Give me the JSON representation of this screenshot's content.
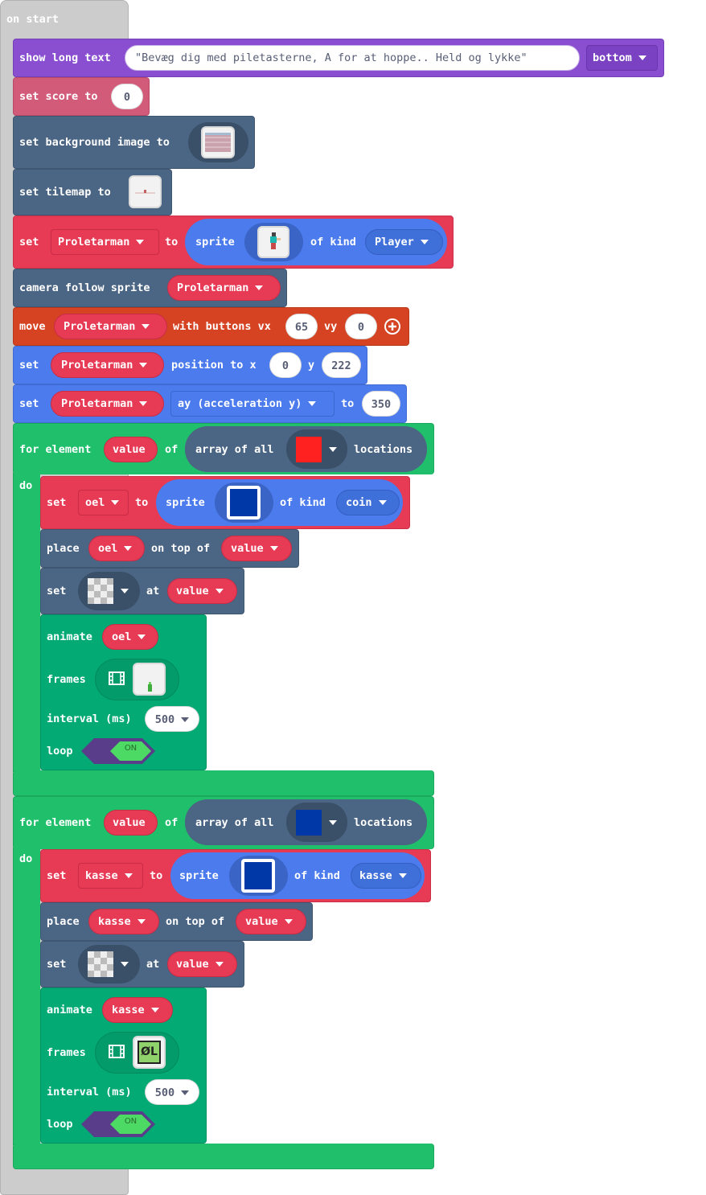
{
  "hat": {
    "label": "on start"
  },
  "show_text": {
    "label": "show long text",
    "text_value": "\"Bevæg dig med piletasterne, A for at hoppe.. Held og lykke\"",
    "position": "bottom"
  },
  "set_score": {
    "label": "set score to",
    "value": "0"
  },
  "set_background": {
    "label": "set background image to"
  },
  "set_tilemap": {
    "label": "set tilemap to"
  },
  "set_sprite": {
    "set": "set",
    "variable": "Proletarman",
    "to": "to",
    "sprite": "sprite",
    "of_kind": "of kind",
    "kind": "Player"
  },
  "camera": {
    "label": "camera follow sprite",
    "variable": "Proletarman"
  },
  "move": {
    "move": "move",
    "variable": "Proletarman",
    "with_buttons": "with buttons vx",
    "vx": "65",
    "vy_label": "vy",
    "vy": "0"
  },
  "position": {
    "set": "set",
    "variable": "Proletarman",
    "position_to": "position to x",
    "x": "0",
    "y_label": "y",
    "y": "222"
  },
  "accel": {
    "set": "set",
    "variable": "Proletarman",
    "property": "ay (acceleration y)",
    "to": "to",
    "value": "350"
  },
  "loop1": {
    "for_element": "for element",
    "value_var": "value",
    "of": "of",
    "array_of_all": "array of all",
    "locations": "locations",
    "do": "do",
    "tile_color": "#FF2020",
    "set": {
      "set": "set",
      "variable": "oel",
      "to": "to",
      "sprite": "sprite",
      "of_kind": "of kind",
      "kind": "coin"
    },
    "place": {
      "place": "place",
      "variable": "oel",
      "on_top_of": "on top of",
      "value": "value"
    },
    "settile": {
      "set": "set",
      "at": "at",
      "value": "value"
    },
    "animate": {
      "animate": "animate",
      "variable": "oel",
      "frames": "frames",
      "interval": "interval (ms)",
      "interval_value": "500",
      "loop": "loop",
      "toggle": "ON"
    }
  },
  "loop2": {
    "for_element": "for element",
    "value_var": "value",
    "of": "of",
    "array_of_all": "array of all",
    "locations": "locations",
    "do": "do",
    "tile_color": "#0038A8",
    "set": {
      "set": "set",
      "variable": "kasse",
      "to": "to",
      "sprite": "sprite",
      "of_kind": "of kind",
      "kind": "kasse"
    },
    "place": {
      "place": "place",
      "variable": "kasse",
      "on_top_of": "on top of",
      "value": "value"
    },
    "settile": {
      "set": "set",
      "at": "at",
      "value": "value"
    },
    "animate": {
      "animate": "animate",
      "variable": "kasse",
      "frames": "frames",
      "frame_text": "ØL",
      "interval": "interval (ms)",
      "interval_value": "500",
      "loop": "loop",
      "toggle": "ON"
    }
  },
  "colors": {
    "event_gray": "#CCCCCC",
    "text_purple": "#8A4FD0",
    "info_pink": "#D25B7A",
    "scene_slate": "#4B6584",
    "sprite_red": "#E63A55",
    "sprite_blue": "#4B7BEC",
    "controller_orange": "#D54322",
    "loops_green": "#20BF6B",
    "animation_green": "#03AA74",
    "toggle_purple": "#5A3D8A",
    "toggle_green": "#4CD964"
  }
}
